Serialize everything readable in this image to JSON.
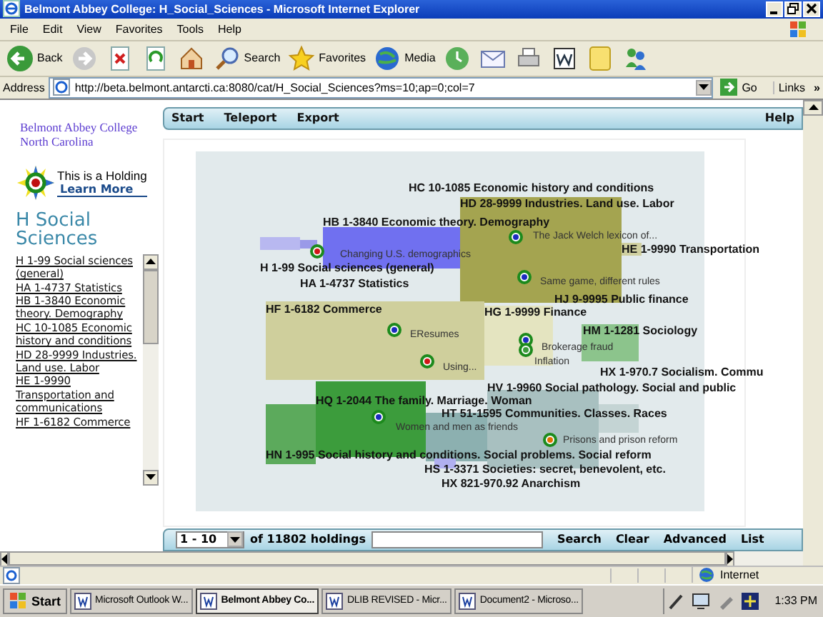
{
  "window": {
    "title": "Belmont Abbey College: H_Social_Sciences - Microsoft Internet Explorer"
  },
  "menu": [
    "File",
    "Edit",
    "View",
    "Favorites",
    "Tools",
    "Help"
  ],
  "toolbar": [
    {
      "kind": "back",
      "label": "Back"
    },
    {
      "kind": "forward"
    },
    {
      "kind": "stop"
    },
    {
      "kind": "refresh"
    },
    {
      "kind": "home"
    },
    {
      "kind": "search",
      "label": "Search"
    },
    {
      "kind": "favorites",
      "label": "Favorites"
    },
    {
      "kind": "media",
      "label": "Media"
    },
    {
      "kind": "history"
    },
    {
      "kind": "mail"
    },
    {
      "kind": "print"
    },
    {
      "kind": "edit"
    },
    {
      "kind": "note"
    },
    {
      "kind": "messenger"
    }
  ],
  "address": {
    "label": "Address",
    "url": "http://beta.belmont.antarcti.ca:8080/cat/H_Social_Sciences?ms=10;ap=0;col=7",
    "go": "Go",
    "links": "Links",
    "more": "»"
  },
  "site": {
    "logo_lines": [
      "Belmont Abbey College",
      "North Carolina"
    ],
    "legend": "This is a Holding",
    "learn_more": "Learn More",
    "heading": "H Social Sciences",
    "subjects": [
      "H 1-99 Social sciences (general)",
      "HA 1-4737 Statistics",
      "HB 1-3840 Economic theory. Demography",
      "HC 10-1085 Economic history and conditions",
      "HD 28-9999 Industries. Land use. Labor",
      "HE 1-9990 Transportation and communications",
      "HF 1-6182 Commerce"
    ]
  },
  "nav": {
    "left": [
      "Start",
      "Teleport",
      "Export"
    ],
    "right": "Help"
  },
  "map": {
    "categories": [
      {
        "label": "HC 10-1085 Economic history and conditions"
      },
      {
        "label": "HD 28-9999 Industries. Land use. Labor",
        "color": "#a4a450"
      },
      {
        "label": "HB 1-3840 Economic theory. Demography",
        "color": "#7070f0"
      },
      {
        "label": "HE 1-9990 Transportation",
        "color": "#d0d0a0"
      },
      {
        "label": "H 1-99 Social sciences (general)",
        "color": "#b8b8f0"
      },
      {
        "label": "HA 1-4737 Statistics",
        "color": "#9a9ae8"
      },
      {
        "label": "HJ 9-9995 Public finance"
      },
      {
        "label": "HF 1-6182 Commerce",
        "color": "#cfcf9c"
      },
      {
        "label": "HG 1-9999 Finance",
        "color": "#e4e4c0"
      },
      {
        "label": "HM 1-1281 Sociology",
        "color": "#8cc48c"
      },
      {
        "label": "HX 1-970.7 Socialism. Commu",
        "color": "#c4d4d4"
      },
      {
        "label": "HV 1-9960 Social pathology. Social and public",
        "color": "#a8c0c0"
      },
      {
        "label": "HQ 1-2044 The family. Marriage. Woman",
        "color": "#3c9c3c"
      },
      {
        "label": "HT 51-1595 Communities. Classes. Races",
        "color": "#8cb0b0"
      },
      {
        "label": "HN 1-995 Social history and conditions. Social problems. Social reform",
        "color": "#5caa5c"
      },
      {
        "label": "HS 1-3371 Societies: secret, benevolent, etc.",
        "color": "#b0b0f0"
      },
      {
        "label": "HX 821-970.92 Anarchism"
      }
    ],
    "holdings": [
      {
        "title": "The Jack Welch lexicon of...",
        "color": "#1c2cc0"
      },
      {
        "title": "Changing U.S. demographics",
        "color": "#d01818"
      },
      {
        "title": "Same game, different rules",
        "color": "#1c2cc0"
      },
      {
        "title": "EResumes",
        "color": "#1c2cc0"
      },
      {
        "title": "Brokerage fraud",
        "color": "#1c2cc0"
      },
      {
        "title": "Inflation",
        "color": "#3c9c3c"
      },
      {
        "title": "Using...",
        "color": "#d01818"
      },
      {
        "title": "Women and men as friends",
        "color": "#1c2cc0"
      },
      {
        "title": "Prisons and prison reform",
        "color": "#e07000"
      }
    ]
  },
  "pager": {
    "range": "1 - 10",
    "count": "of 11802 holdings",
    "actions": [
      "Search",
      "Clear",
      "Advanced",
      "List"
    ]
  },
  "status": {
    "zone": "Internet"
  },
  "taskbar": {
    "start": "Start",
    "tasks": [
      {
        "label": "Microsoft Outlook W...",
        "selected": false
      },
      {
        "label": "Belmont Abbey Co...",
        "selected": true
      },
      {
        "label": "DLIB REVISED - Micr...",
        "selected": false
      },
      {
        "label": "Document2 - Microso...",
        "selected": false
      }
    ],
    "clock": "1:33 PM"
  }
}
